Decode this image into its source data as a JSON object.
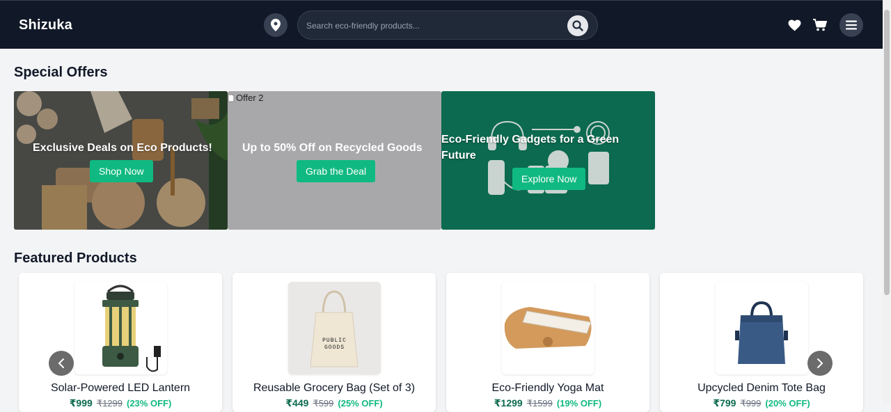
{
  "header": {
    "brand": "Shizuka",
    "search_placeholder": "Search eco-friendly products...",
    "icons": [
      "location-icon",
      "search-icon",
      "heart-icon",
      "cart-icon",
      "menu-icon"
    ]
  },
  "offers": {
    "title": "Special Offers",
    "banners": [
      {
        "title": "Exclusive Deals on Eco Products!",
        "button": "Shop Now"
      },
      {
        "alt": "Offer 2",
        "title": "Up to 50% Off on Recycled Goods",
        "button": "Grab the Deal"
      },
      {
        "title": "Eco-Friendly Gadgets for a Green Future",
        "button": "Explore Now"
      }
    ]
  },
  "featured": {
    "title": "Featured Products",
    "products": [
      {
        "name": "Solar-Powered LED Lantern",
        "price": "₹999",
        "old_price": "₹1299",
        "discount": "(23% OFF)"
      },
      {
        "name": "Reusable Grocery Bag (Set of 3)",
        "price": "₹449",
        "old_price": "₹599",
        "discount": "(25% OFF)",
        "bag_text": "PUBLIC GOODS"
      },
      {
        "name": "Eco-Friendly Yoga Mat",
        "price": "₹1299",
        "old_price": "₹1599",
        "discount": "(19% OFF)"
      },
      {
        "name": "Upcycled Denim Tote Bag",
        "price": "₹799",
        "old_price": "₹999",
        "discount": "(20% OFF)"
      }
    ]
  },
  "colors": {
    "navbar": "#111827",
    "accent": "#10b981",
    "price": "#0b6a4f",
    "banner3": "#0b6a4f"
  }
}
